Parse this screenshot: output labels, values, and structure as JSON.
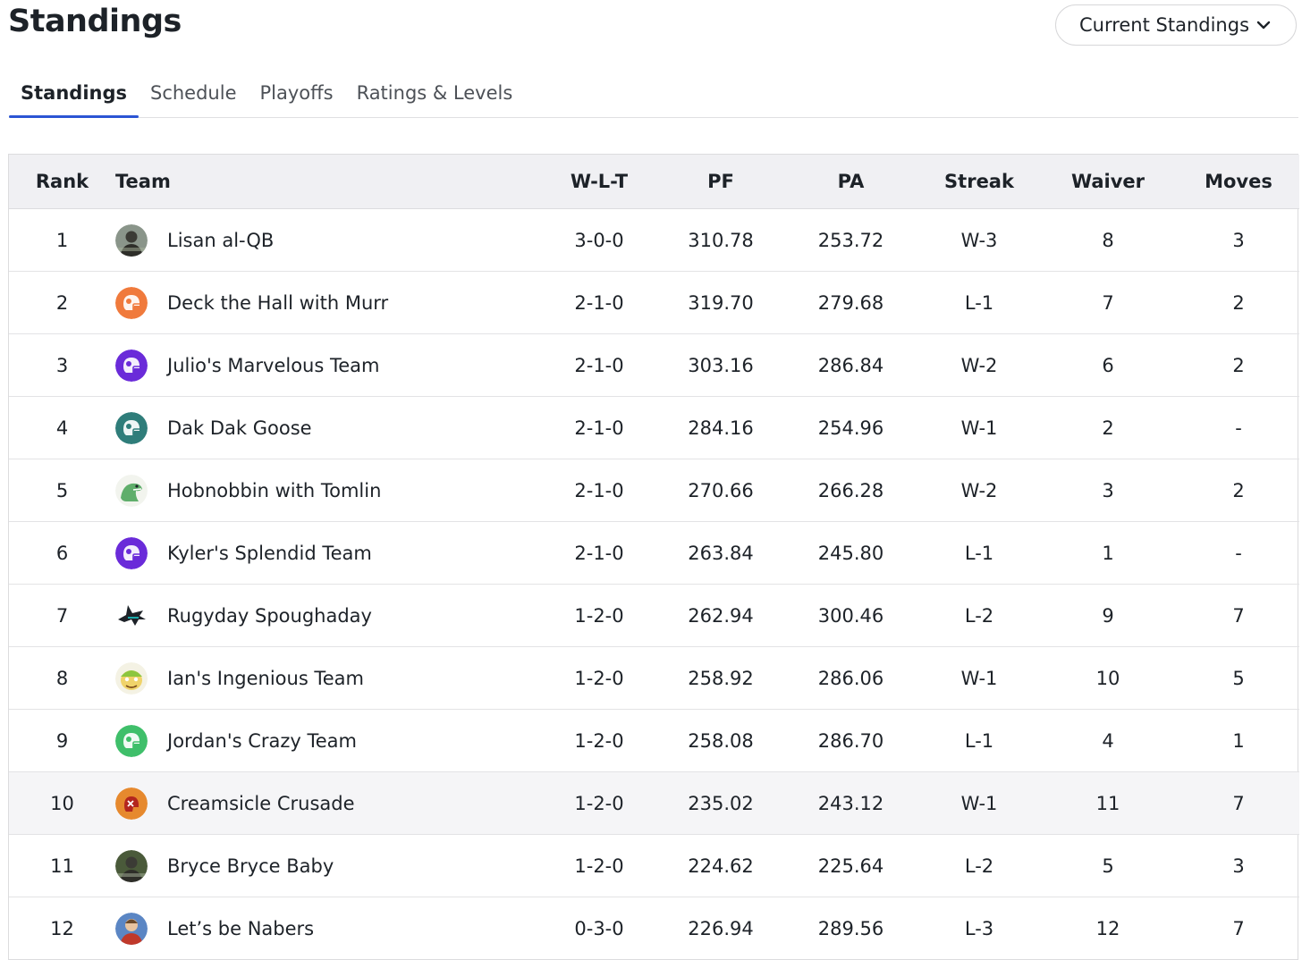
{
  "page": {
    "title": "Standings"
  },
  "view_select": {
    "value": "Current Standings"
  },
  "tabs": [
    {
      "label": "Standings",
      "active": true
    },
    {
      "label": "Schedule",
      "active": false
    },
    {
      "label": "Playoffs",
      "active": false
    },
    {
      "label": "Ratings & Levels",
      "active": false
    }
  ],
  "table": {
    "headers": {
      "rank": "Rank",
      "team": "Team",
      "wlt": "W-L-T",
      "pf": "PF",
      "pa": "PA",
      "streak": "Streak",
      "waiver": "Waiver",
      "moves": "Moves"
    },
    "rows": [
      {
        "rank": "1",
        "team": "Lisan al-QB",
        "avatar": "photo-avatar-icon",
        "avatar_color": "#8a958a",
        "wlt": "3-0-0",
        "pf": "310.78",
        "pa": "253.72",
        "streak": "W-3",
        "waiver": "8",
        "moves": "3"
      },
      {
        "rank": "2",
        "team": "Deck the Hall with Murr",
        "avatar": "helmet-icon",
        "avatar_color": "#f07a3c",
        "wlt": "2-1-0",
        "pf": "319.70",
        "pa": "279.68",
        "streak": "L-1",
        "waiver": "7",
        "moves": "2"
      },
      {
        "rank": "3",
        "team": "Julio's Marvelous Team",
        "avatar": "helmet-icon",
        "avatar_color": "#6a2bd9",
        "wlt": "2-1-0",
        "pf": "303.16",
        "pa": "286.84",
        "streak": "W-2",
        "waiver": "6",
        "moves": "2"
      },
      {
        "rank": "4",
        "team": "Dak Dak Goose",
        "avatar": "helmet-icon",
        "avatar_color": "#2f7d7a",
        "wlt": "2-1-0",
        "pf": "284.16",
        "pa": "254.96",
        "streak": "W-1",
        "waiver": "2",
        "moves": "-"
      },
      {
        "rank": "5",
        "team": "Hobnobbin with Tomlin",
        "avatar": "dinosaur-icon",
        "avatar_color": "#5fae6b",
        "wlt": "2-1-0",
        "pf": "270.66",
        "pa": "266.28",
        "streak": "W-2",
        "waiver": "3",
        "moves": "2"
      },
      {
        "rank": "6",
        "team": "Kyler's Splendid Team",
        "avatar": "helmet-icon",
        "avatar_color": "#6a2bd9",
        "wlt": "2-1-0",
        "pf": "263.84",
        "pa": "245.80",
        "streak": "L-1",
        "waiver": "1",
        "moves": "-"
      },
      {
        "rank": "7",
        "team": "Rugyday Spoughaday",
        "avatar": "shark-icon",
        "avatar_color": "#1d2228",
        "wlt": "1-2-0",
        "pf": "262.94",
        "pa": "300.46",
        "streak": "L-2",
        "waiver": "9",
        "moves": "7"
      },
      {
        "rank": "8",
        "team": "Ian's Ingenious Team",
        "avatar": "cartoon-face-icon",
        "avatar_color": "#8cc63f",
        "wlt": "1-2-0",
        "pf": "258.92",
        "pa": "286.06",
        "streak": "W-1",
        "waiver": "10",
        "moves": "5"
      },
      {
        "rank": "9",
        "team": "Jordan's Crazy Team",
        "avatar": "helmet-icon",
        "avatar_color": "#3fbf6a",
        "wlt": "1-2-0",
        "pf": "258.08",
        "pa": "286.70",
        "streak": "L-1",
        "waiver": "4",
        "moves": "1"
      },
      {
        "rank": "10",
        "team": "Creamsicle Crusade",
        "avatar": "pirate-helmet-icon",
        "avatar_color": "#e6892e",
        "highlight": true,
        "wlt": "1-2-0",
        "pf": "235.02",
        "pa": "243.12",
        "streak": "W-1",
        "waiver": "11",
        "moves": "7"
      },
      {
        "rank": "11",
        "team": "Bryce Bryce Baby",
        "avatar": "photo-avatar-icon",
        "avatar_color": "#4a5a3a",
        "wlt": "1-2-0",
        "pf": "224.62",
        "pa": "225.64",
        "streak": "L-2",
        "waiver": "5",
        "moves": "3"
      },
      {
        "rank": "12",
        "team": "Let’s be Nabers",
        "avatar": "portrait-avatar-icon",
        "avatar_color": "#5b86c4",
        "wlt": "0-3-0",
        "pf": "226.94",
        "pa": "289.56",
        "streak": "L-3",
        "waiver": "12",
        "moves": "7"
      }
    ]
  }
}
